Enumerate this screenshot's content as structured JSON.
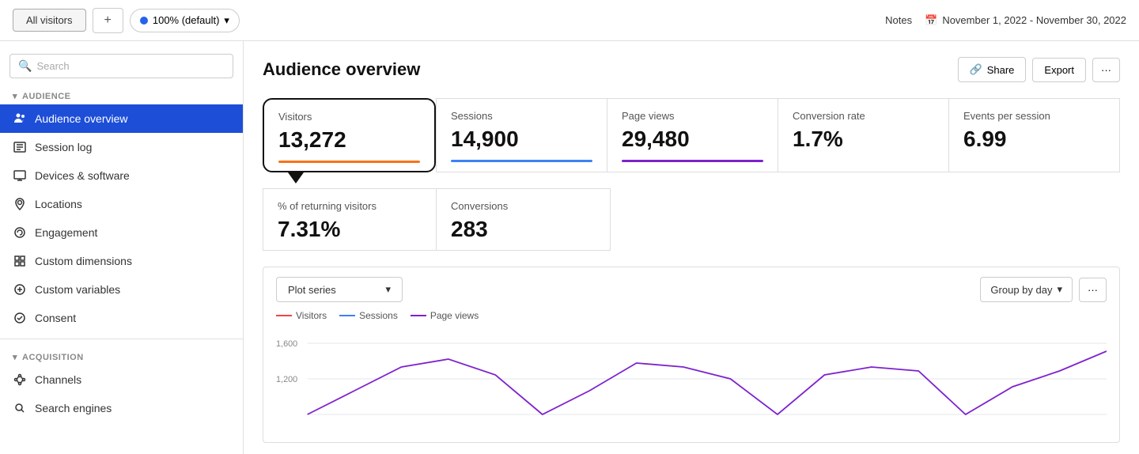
{
  "topbar": {
    "tab_all_visitors": "All visitors",
    "tab_add": "+",
    "segment_label": "100% (default)",
    "notes_label": "Notes",
    "date_range": "November 1, 2022 - November 30, 2022"
  },
  "sidebar": {
    "search_placeholder": "Search",
    "section_audience": "AUDIENCE",
    "section_acquisition": "ACQUISITION",
    "nav_items_audience": [
      {
        "label": "Audience overview",
        "active": true,
        "icon": "users"
      },
      {
        "label": "Session log",
        "active": false,
        "icon": "list"
      },
      {
        "label": "Devices & software",
        "active": false,
        "icon": "monitor"
      },
      {
        "label": "Locations",
        "active": false,
        "icon": "pin"
      },
      {
        "label": "Engagement",
        "active": false,
        "icon": "engagement"
      },
      {
        "label": "Custom dimensions",
        "active": false,
        "icon": "custom-dim"
      },
      {
        "label": "Custom variables",
        "active": false,
        "icon": "custom-var"
      },
      {
        "label": "Consent",
        "active": false,
        "icon": "consent"
      }
    ],
    "nav_items_acquisition": [
      {
        "label": "Channels",
        "active": false,
        "icon": "channels"
      },
      {
        "label": "Search engines",
        "active": false,
        "icon": "search-eng"
      }
    ]
  },
  "page": {
    "title": "Audience overview",
    "share_label": "Share",
    "export_label": "Export",
    "more_label": "···"
  },
  "stats": {
    "visitors": {
      "label": "Visitors",
      "value": "13,272",
      "bar": "orange"
    },
    "sessions": {
      "label": "Sessions",
      "value": "14,900",
      "bar": "blue"
    },
    "page_views": {
      "label": "Page views",
      "value": "29,480",
      "bar": "purple"
    },
    "conversion_rate": {
      "label": "Conversion rate",
      "value": "1.7%",
      "bar": "none"
    },
    "events_per_session": {
      "label": "Events per session",
      "value": "6.99",
      "bar": "none"
    },
    "returning_visitors": {
      "label": "% of returning visitors",
      "value": "7.31%"
    },
    "conversions": {
      "label": "Conversions",
      "value": "283"
    }
  },
  "chart": {
    "plot_series_label": "Plot series",
    "group_by_label": "Group by day",
    "legend": [
      {
        "label": "Visitors",
        "color": "red"
      },
      {
        "label": "Sessions",
        "color": "blue"
      },
      {
        "label": "Page views",
        "color": "purple"
      }
    ],
    "y_labels": [
      "1,600",
      "1,200"
    ]
  },
  "icons": {
    "chevron_down": "▾",
    "calendar": "📅",
    "link": "🔗",
    "chevron_left": "◂",
    "search": "🔍"
  }
}
